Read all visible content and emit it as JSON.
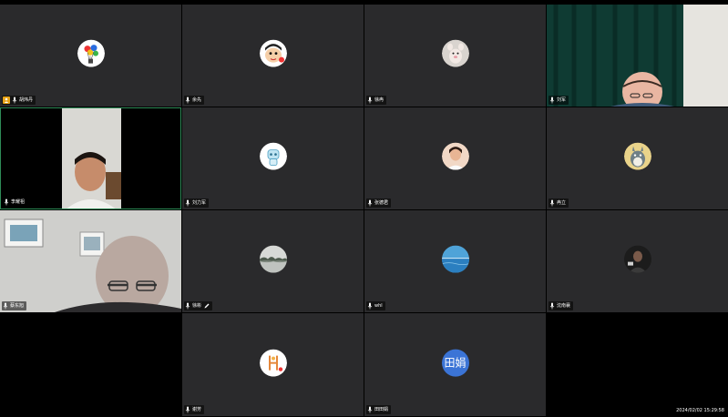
{
  "participants": [
    {
      "name": "胡炜丹",
      "kind": "avatar",
      "icon": "balloons-avatar-icon",
      "host": true
    },
    {
      "name": "余先",
      "kind": "avatar",
      "icon": "cartoon-face-avatar-icon"
    },
    {
      "name": "徐冉",
      "kind": "avatar",
      "icon": "cartoon-animal-avatar-icon"
    },
    {
      "name": "刘军",
      "kind": "video",
      "icon": "video-feed-man-curtain"
    },
    {
      "name": "李耀祖",
      "kind": "video",
      "icon": "video-feed-man-room",
      "active": true
    },
    {
      "name": "刘力军",
      "kind": "avatar",
      "icon": "cartoon-robot-avatar-icon"
    },
    {
      "name": "张德君",
      "kind": "avatar",
      "icon": "girl-photo-avatar-icon"
    },
    {
      "name": "冉立",
      "kind": "avatar",
      "icon": "totoro-avatar-icon"
    },
    {
      "name": "蔡东旭",
      "kind": "video",
      "icon": "video-feed-man-glasses"
    },
    {
      "name": "徐彬",
      "kind": "avatar",
      "icon": "landscape-avatar-icon",
      "editing": true
    },
    {
      "name": "whl",
      "kind": "avatar",
      "icon": "ocean-avatar-icon"
    },
    {
      "name": "沈南襄",
      "kind": "avatar",
      "icon": "dark-photo-avatar-icon"
    },
    {
      "name": "谢芳",
      "kind": "avatar",
      "icon": "drawing-avatar-icon"
    },
    {
      "name": "田田娟",
      "kind": "text-avatar",
      "avatar_text": "田娟",
      "avatar_color": "#3b74d6"
    }
  ],
  "timestamp": "2024/02/02 15:29:58",
  "colors": {
    "tile": "#2a2a2c",
    "active_border": "#2e8b57",
    "host_badge": "#e8a316"
  }
}
